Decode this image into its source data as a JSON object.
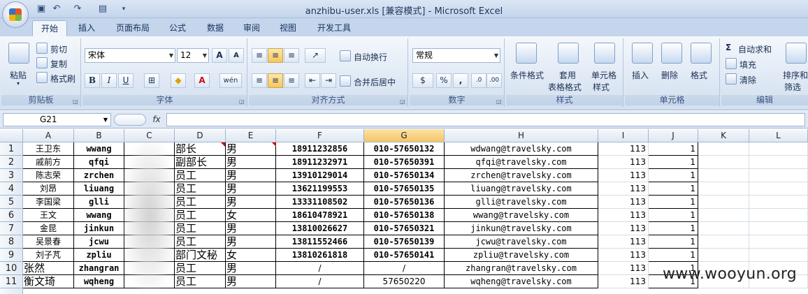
{
  "window": {
    "title": "anzhibu-user.xls  [兼容模式] - Microsoft Excel"
  },
  "tabs": [
    "开始",
    "插入",
    "页面布局",
    "公式",
    "数据",
    "审阅",
    "视图",
    "开发工具"
  ],
  "ribbon": {
    "clipboard": {
      "paste": "粘贴",
      "cut": "剪切",
      "copy": "复制",
      "format_painter": "格式刷",
      "label": "剪贴板"
    },
    "font": {
      "name": "宋体",
      "size": "12",
      "label": "字体",
      "bold": "B",
      "italic": "I",
      "underline": "U",
      "grow": "A",
      "shrink": "A",
      "font_color": "A",
      "fill": "◆",
      "phonetic": "wén"
    },
    "alignment": {
      "wrap": "自动换行",
      "merge": "合并后居中",
      "label": "对齐方式"
    },
    "number": {
      "format": "常规",
      "percent": "%",
      "comma": ",",
      "label": "数字"
    },
    "styles": {
      "conditional": "条件格式",
      "table1": "套用",
      "table2": "表格格式",
      "cell1": "单元格",
      "cell2": "样式",
      "label": "样式"
    },
    "cells": {
      "insert": "插入",
      "delete": "删除",
      "format": "格式",
      "label": "单元格"
    },
    "editing": {
      "autosum": "自动求和",
      "fill": "填充",
      "clear": "清除",
      "sort1": "排序和",
      "sort2": "筛选",
      "label": "编辑"
    }
  },
  "formula_bar": {
    "name_box": "G21",
    "fx": "fx",
    "value": ""
  },
  "columns": [
    "A",
    "B",
    "C",
    "D",
    "E",
    "F",
    "G",
    "H",
    "I",
    "J",
    "K",
    "L"
  ],
  "rows": [
    {
      "n": "1",
      "a": "王卫东",
      "b": "wwang",
      "d": "部长",
      "e": "男",
      "f": "18911232856",
      "g": "010-57650132",
      "h": "wdwang@travelsky.com",
      "i": "113",
      "j": "1"
    },
    {
      "n": "2",
      "a": "戚前方",
      "b": "qfqi",
      "d": "副部长",
      "e": "男",
      "f": "18911232971",
      "g": "010-57650391",
      "h": "qfqi@travelsky.com",
      "i": "113",
      "j": "1"
    },
    {
      "n": "3",
      "a": "陈志荣",
      "b": "zrchen",
      "d": "员工",
      "e": "男",
      "f": "13910129014",
      "g": "010-57650134",
      "h": "zrchen@travelsky.com",
      "i": "113",
      "j": "1"
    },
    {
      "n": "4",
      "a": "刘昂",
      "b": "liuang",
      "d": "员工",
      "e": "男",
      "f": "13621199553",
      "g": "010-57650135",
      "h": "liuang@travelsky.com",
      "i": "113",
      "j": "1"
    },
    {
      "n": "5",
      "a": "李国梁",
      "b": "glli",
      "d": "员工",
      "e": "男",
      "f": "13331108502",
      "g": "010-57650136",
      "h": "glli@travelsky.com",
      "i": "113",
      "j": "1"
    },
    {
      "n": "6",
      "a": "王文",
      "b": "wwang",
      "d": "员工",
      "e": "女",
      "f": "18610478921",
      "g": "010-57650138",
      "h": "wwang@travelsky.com",
      "i": "113",
      "j": "1"
    },
    {
      "n": "7",
      "a": "金昆",
      "b": "jinkun",
      "d": "员工",
      "e": "男",
      "f": "13810026627",
      "g": "010-57650321",
      "h": "jinkun@travelsky.com",
      "i": "113",
      "j": "1"
    },
    {
      "n": "8",
      "a": "吴景春",
      "b": "jcwu",
      "d": "员工",
      "e": "男",
      "f": "13811552466",
      "g": "010-57650139",
      "h": "jcwu@travelsky.com",
      "i": "113",
      "j": "1"
    },
    {
      "n": "9",
      "a": "刘子芃",
      "b": "zpliu",
      "d": "部门文秘",
      "e": "女",
      "f": "13810261818",
      "g": "010-57650141",
      "h": "zpliu@travelsky.com",
      "i": "113",
      "j": "1"
    },
    {
      "n": "10",
      "a": "张然",
      "b": "zhangran",
      "d": "员工",
      "e": "男",
      "f": "/",
      "g": "/",
      "h": "zhangran@travelsky.com",
      "i": "113",
      "j": "1"
    },
    {
      "n": "11",
      "a": "衡文琦",
      "b": "wqheng",
      "d": "员工",
      "e": "男",
      "f": "/",
      "g": "57650220",
      "h": "wqheng@travelsky.com",
      "i": "113",
      "j": "1"
    }
  ],
  "watermark": "www.wooyun.org"
}
